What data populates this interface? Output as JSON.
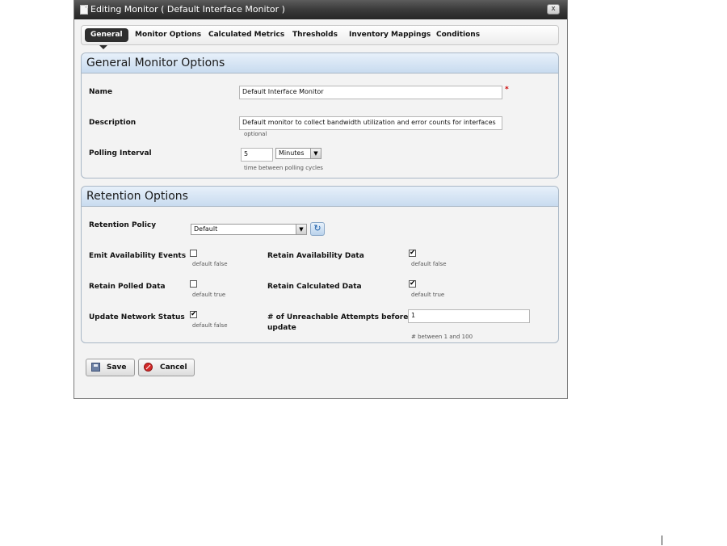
{
  "dialog": {
    "title": "Editing Monitor ( Default Interface Monitor )",
    "close_label": "x"
  },
  "tabs": [
    {
      "label": "General",
      "active": true
    },
    {
      "label": "Monitor Options"
    },
    {
      "label": "Calculated Metrics"
    },
    {
      "label": "Thresholds"
    },
    {
      "label": "Inventory Mappings"
    },
    {
      "label": "Conditions"
    }
  ],
  "general": {
    "header": "General Monitor Options",
    "name_label": "Name",
    "name_value": "Default Interface Monitor",
    "required_mark": "*",
    "description_label": "Description",
    "description_value": "Default monitor to collect bandwidth utilization and error counts for interfaces",
    "description_hint": "optional",
    "polling_label": "Polling Interval",
    "polling_value": "5",
    "polling_unit": "Minutes",
    "polling_hint": "time between polling cycles"
  },
  "retention": {
    "header": "Retention Options",
    "policy_label": "Retention Policy",
    "policy_value": "Default",
    "emit_label": "Emit Availability Events",
    "emit_hint": "default false",
    "emit_checked": false,
    "retain_avail_label": "Retain Availability Data",
    "retain_avail_hint": "default false",
    "retain_avail_checked": true,
    "retain_polled_label": "Retain Polled Data",
    "retain_polled_hint": "default true",
    "retain_polled_checked": false,
    "retain_calc_label": "Retain Calculated Data",
    "retain_calc_hint": "default true",
    "retain_calc_checked": true,
    "update_net_label": "Update Network Status",
    "update_net_hint": "default false",
    "update_net_checked": true,
    "unreach_label_1": "# of Unreachable Attempts before",
    "unreach_label_2": "update",
    "unreach_value": "1",
    "unreach_hint": "# between 1 and 100"
  },
  "buttons": {
    "save": "Save",
    "cancel": "Cancel"
  },
  "icons": {
    "title": "document-icon",
    "close": "close-icon",
    "save": "save-icon",
    "cancel": "cancel-icon",
    "refresh": "refresh-icon",
    "dropdown": "chevron-down-icon"
  },
  "check_glyph": "✔",
  "arrow_glyph": "▼",
  "refresh_glyph": "↻"
}
